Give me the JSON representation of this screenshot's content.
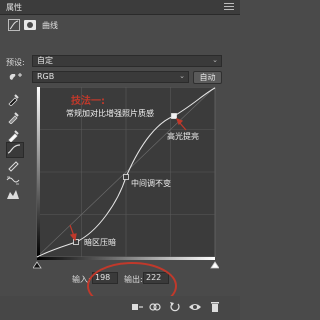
{
  "panel": {
    "title": "属性"
  },
  "header": {
    "label": "曲线"
  },
  "preset": {
    "label": "预设:",
    "value": "自定"
  },
  "channel": {
    "value": "RGB",
    "auto_label": "自动"
  },
  "annotations": {
    "heading": "技法一:",
    "description": "常规加对比增强照片质感",
    "highlight": "高光提亮",
    "midtone": "中间调不变",
    "shadow": "暗区压暗"
  },
  "readout": {
    "input_label": "输入:",
    "input_value": "198",
    "output_label": "输出:",
    "output_value": "222"
  },
  "colors": {
    "annotation_red": "#c0392b",
    "panel_bg": "#4a4a4a",
    "graph_bg": "#3b3b3b"
  },
  "icons": [
    "adjustment-icon",
    "mask-icon",
    "hand-target-icon",
    "eyedropper-black-icon",
    "eyedropper-gray-icon",
    "eyedropper-white-icon",
    "curve-icon",
    "pencil-icon",
    "smooth-icon",
    "clipping-warning-icon",
    "clip-to-layer-icon",
    "view-previous-icon",
    "reset-icon",
    "visibility-icon",
    "delete-icon"
  ]
}
